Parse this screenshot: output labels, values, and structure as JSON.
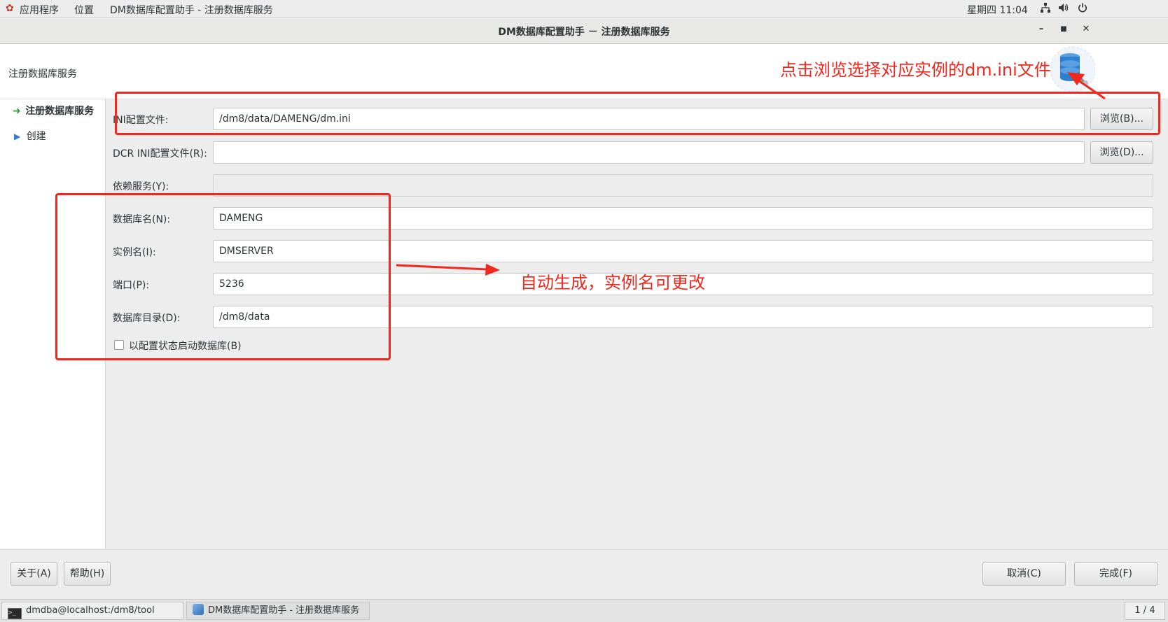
{
  "topbar": {
    "applications": "应用程序",
    "places": "位置",
    "active_app": "DM数据库配置助手 - 注册数据库服务",
    "clock": "星期四 11:04"
  },
  "window": {
    "title": "DM数据库配置助手 － 注册数据库服务"
  },
  "header": {
    "page_title": "注册数据库服务"
  },
  "nav": {
    "items": [
      {
        "label": "注册数据库服务"
      },
      {
        "label": "创建"
      }
    ]
  },
  "form": {
    "ini_label": "INI配置文件:",
    "ini_value": "/dm8/data/DAMENG/dm.ini",
    "browse_b": "浏览(B)...",
    "dcr_label": "DCR INI配置文件(R):",
    "dcr_value": "",
    "browse_d": "浏览(D)...",
    "depend_label": "依赖服务(Y):",
    "depend_value": "",
    "dbname_label": "数据库名(N):",
    "dbname_value": "DAMENG",
    "instance_label": "实例名(I):",
    "instance_value": "DMSERVER",
    "port_label": "端口(P):",
    "port_value": "5236",
    "dbdir_label": "数据库目录(D):",
    "dbdir_value": "/dm8/data",
    "config_start_label": "以配置状态启动数据库(B)",
    "config_start_checked": false
  },
  "footer": {
    "about": "关于(A)",
    "help": "帮助(H)",
    "cancel": "取消(C)",
    "finish": "完成(F)"
  },
  "taskbar": {
    "terminal": "dmdba@localhost:/dm8/tool",
    "app": "DM数据库配置助手 - 注册数据库服务",
    "workspace": "1 / 4"
  },
  "annotations": {
    "browse_hint": "点击浏览选择对应实例的dm.ini文件",
    "auto_hint": "自动生成，实例名可更改"
  },
  "colors": {
    "annotation": "#f0281e",
    "nav_arrow_current": "#2e9c3b",
    "nav_arrow_next": "#3a78c8"
  }
}
